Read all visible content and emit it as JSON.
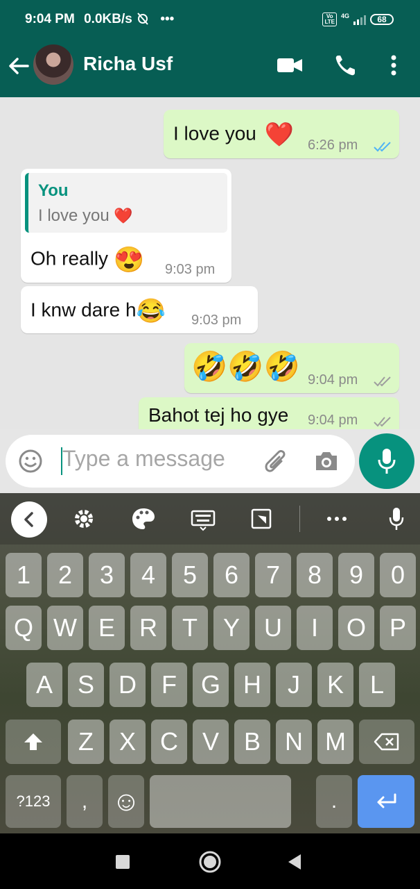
{
  "status": {
    "time": "9:04 PM",
    "speed": "0.0KB/s",
    "overflow": "•••",
    "lte": "Vo\nLTE",
    "network": "4G",
    "battery": "68"
  },
  "header": {
    "contact_name": "Richa Usf"
  },
  "messages": [
    {
      "type": "out",
      "text": "I love you",
      "emoji": "❤️",
      "time": "6:26 pm",
      "ticks_color": "#4fb3f6"
    },
    {
      "type": "in",
      "quote_name": "You",
      "quote_text": "I love you",
      "quote_emoji": "❤️",
      "text": "Oh really",
      "emoji": "😍",
      "time": "9:03 pm"
    },
    {
      "type": "in",
      "text": "I knw dare h",
      "emoji": "😂",
      "time": "9:03 pm"
    },
    {
      "type": "out",
      "text": "🤣🤣🤣",
      "time": "9:04 pm",
      "ticks_color": "#9e9e9e"
    },
    {
      "type": "out",
      "text": "Bahot tej ho gye",
      "time": "9:04 pm",
      "ticks_color": "#9e9e9e"
    }
  ],
  "composer": {
    "placeholder": "Type a message"
  },
  "keyboard": {
    "row_numbers": [
      "1",
      "2",
      "3",
      "4",
      "5",
      "6",
      "7",
      "8",
      "9",
      "0"
    ],
    "row_top": [
      "Q",
      "W",
      "E",
      "R",
      "T",
      "Y",
      "U",
      "I",
      "O",
      "P"
    ],
    "row_home": [
      "A",
      "S",
      "D",
      "F",
      "G",
      "H",
      "J",
      "K",
      "L"
    ],
    "row_bottom": [
      "Z",
      "X",
      "C",
      "V",
      "B",
      "N",
      "M"
    ],
    "symbols_label": "?123",
    "comma": ",",
    "period": ".",
    "emoji_glyph": "☺"
  },
  "colors": {
    "brand": "#075e54",
    "accent": "#07927e",
    "outgoing_bubble": "#dcf8c6",
    "enter_key": "#5a96f0"
  }
}
